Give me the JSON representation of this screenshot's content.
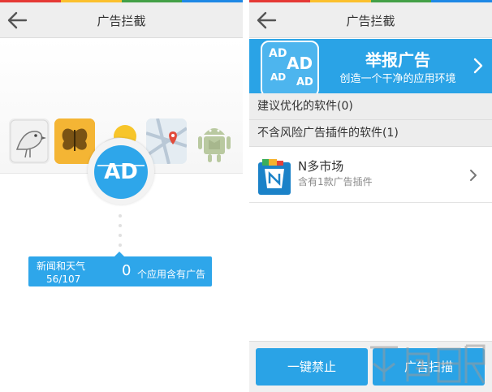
{
  "colors": {
    "accent": "#2aa3e6",
    "ad_blue": "#2ea6ea",
    "titlebar": "#eeeeee",
    "section": "#ededed"
  },
  "top_colorbar": [
    "#e53935",
    "#fbc02d",
    "#43a047",
    "#1e88e5"
  ],
  "left": {
    "title": "广告拦截",
    "back_icon": "back-arrow-icon",
    "apps": [
      {
        "name": "bird-app-icon"
      },
      {
        "name": "butterfly-app-icon"
      },
      {
        "name": "weather-app-icon"
      },
      {
        "name": "maps-app-icon"
      },
      {
        "name": "android-app-icon"
      }
    ],
    "scan_badge": "AD",
    "stat": {
      "category": "新闻和天气",
      "progress": "56/107",
      "count": "0",
      "count_label": "个应用含有广告"
    }
  },
  "right": {
    "title": "广告拦截",
    "back_icon": "back-arrow-icon",
    "banner": {
      "title": "举报广告",
      "subtitle": "创造一个干净的应用环境",
      "ad_words": [
        "AD",
        "AD",
        "AD",
        "AD"
      ]
    },
    "sections": [
      {
        "label": "建议优化的软件(0)"
      },
      {
        "label": "不含风险广告插件的软件(1)"
      }
    ],
    "app_row": {
      "name": "N多市场",
      "desc": "含有1款广告插件"
    },
    "buttons": {
      "block_all": "一键禁止",
      "ad_scan": "广告扫描"
    }
  }
}
